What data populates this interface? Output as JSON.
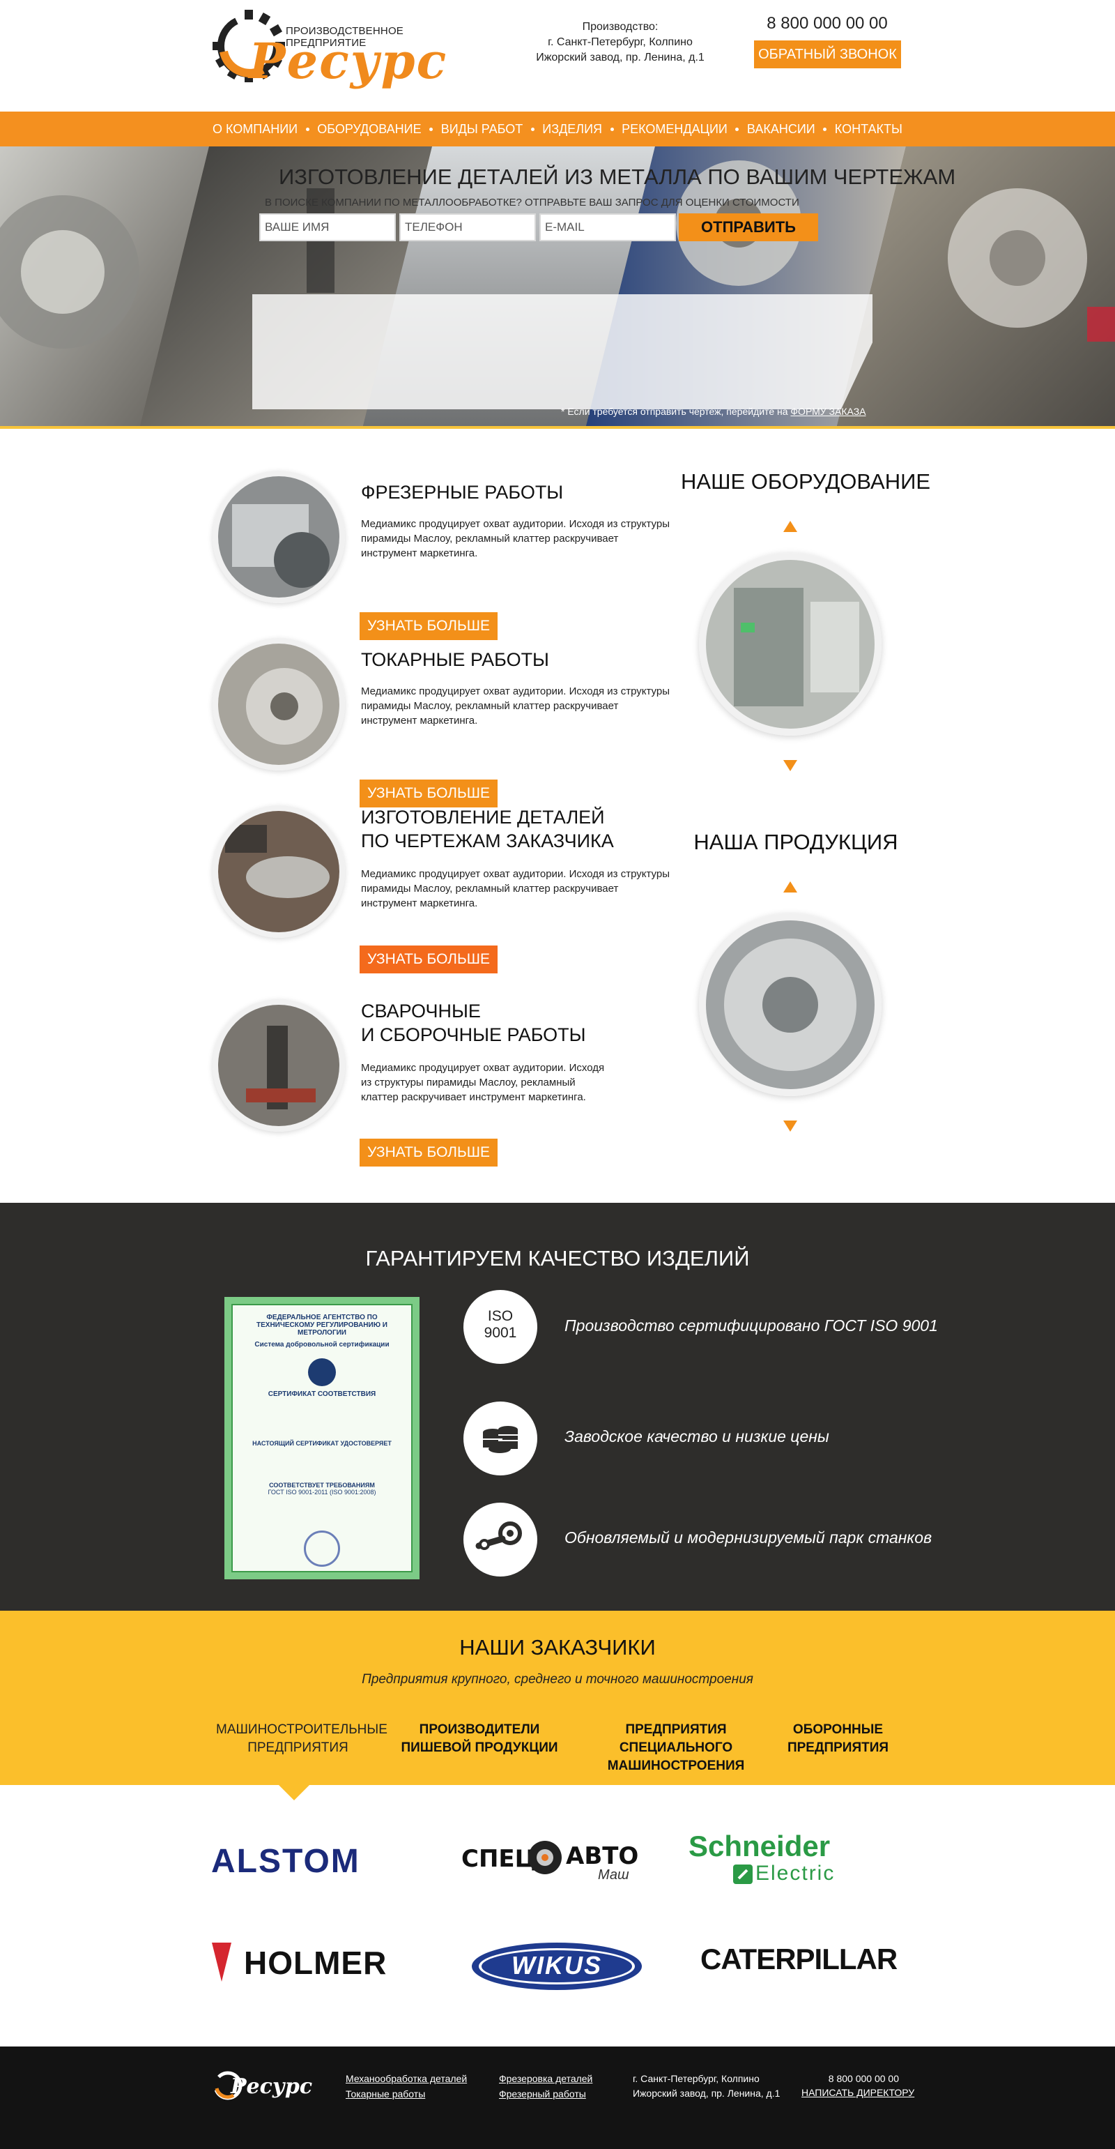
{
  "header": {
    "logo_tagline": "ПРОИЗВОДСТВЕННОЕ ПРЕДПРИЯТИЕ",
    "logo_name": "Ресурс",
    "address_lines": [
      "Производство:",
      "г. Санкт-Петербург, Колпино",
      "Ижорский завод, пр. Ленина, д.1"
    ],
    "phone": "8 800 000 00 00",
    "callback_label": "ОБРАТНЫЙ ЗВОНОК"
  },
  "nav": {
    "items": [
      "О КОМПАНИИ",
      "ОБОРУДОВАНИЕ",
      "ВИДЫ РАБОТ",
      "ИЗДЕЛИЯ",
      "РЕКОМЕНДАЦИИ",
      "ВАКАНСИИ",
      "КОНТАКТЫ"
    ]
  },
  "hero": {
    "title": "ИЗГОТОВЛЕНИЕ ДЕТАЛЕЙ ИЗ МЕТАЛЛА ПО ВАШИМ ЧЕРТЕЖАМ",
    "subtitle": "В ПОИСКЕ КОМПАНИИ ПО МЕТАЛЛООБРАБОТКЕ? ОТПРАВЬТЕ ВАШ ЗАПРОС ДЛЯ ОЦЕНКИ СТОИМОСТИ",
    "name_placeholder": "ВАШЕ ИМЯ",
    "phone_placeholder": "ТЕЛЕФОН",
    "email_placeholder": "E-MAIL",
    "submit_label": "ОТПРАВИТЬ",
    "note_prefix": "* Если требуется отправить чертеж, перейдите на ",
    "note_link": "ФОРМУ ЗАКАЗА"
  },
  "services": [
    {
      "title_lines": [
        "ФРЕЗЕРНЫЕ РАБОТЫ"
      ],
      "description": "Медиамикс продуцирует охват аудитории. Исходя из структуры пирамиды Маслоу, рекламный клаттер раскручивает инструмент маркетинга.",
      "button": "УЗНАТЬ БОЛЬШЕ"
    },
    {
      "title_lines": [
        "ТОКАРНЫЕ РАБОТЫ"
      ],
      "description": "Медиамикс продуцирует охват аудитории. Исходя из структуры пирамиды Маслоу, рекламный клаттер раскручивает инструмент маркетинга.",
      "button": "УЗНАТЬ БОЛЬШЕ"
    },
    {
      "title_lines": [
        "ИЗГОТОВЛЕНИЕ ДЕТАЛЕЙ",
        "ПО ЧЕРТЕЖАМ ЗАКАЗЧИКА"
      ],
      "description": "Медиамикс продуцирует охват аудитории. Исходя из структуры пирамиды Маслоу, рекламный клаттер раскручивает инструмент маркетинга.",
      "button": "УЗНАТЬ БОЛЬШЕ"
    },
    {
      "title_lines": [
        "СВАРОЧНЫЕ",
        "И СБОРОЧНЫЕ РАБОТЫ"
      ],
      "description": "Медиамикс продуцирует охват аудитории. Исходя из структуры пирамиды Маслоу, рекламный клаттер раскручивает инструмент маркетинга.",
      "button": "УЗНАТЬ БОЛЬШЕ"
    }
  ],
  "side": {
    "equipment_title": "НАШЕ ОБОРУДОВАНИЕ",
    "products_title": "НАША ПРОДУКЦИЯ"
  },
  "quality": {
    "title": "ГАРАНТИРУЕМ КАЧЕСТВО ИЗДЕЛИЙ",
    "iso_line1": "ISO",
    "iso_line2": "9001",
    "features": [
      "Производство  сертифицировано ГОСТ ISO 9001",
      "Заводское качество и низкие цены",
      "Обновляемый и модернизируемый парк станков"
    ],
    "certificate": {
      "agency": "ФЕДЕРАЛЬНОЕ АГЕНТСТВО ПО ТЕХНИЧЕСКОМУ РЕГУЛИРОВАНИЮ И МЕТРОЛОГИИ",
      "system": "Система добровольной сертификации",
      "heading": "СЕРТИФИКАТ СООТВЕТСТВИЯ",
      "confirms": "НАСТОЯЩИЙ СЕРТИФИКАТ УДОСТОВЕРЯЕТ",
      "complies": "СООТВЕТСТВУЕТ ТРЕБОВАНИЯМ",
      "standard": "ГОСТ ISO 9001-2011 (ISO 9001:2008)"
    }
  },
  "customers": {
    "title": "НАШИ ЗАКАЗЧИКИ",
    "subtitle": "Предприятия крупного, среднего и точного машиностроения",
    "tabs": [
      [
        "МАШИНОСТРОИТЕЛЬНЫЕ",
        "ПРЕДПРИЯТИЯ"
      ],
      [
        "ПРОИЗВОДИТЕЛИ",
        "ПИШЕВОЙ ПРОДУКЦИИ"
      ],
      [
        "ПРЕДПРИЯТИЯ СПЕЦИАЛЬНОГО",
        "МАШИНОСТРОЕНИЯ"
      ],
      [
        "ОБОРОННЫЕ",
        "ПРЕДПРИЯТИЯ"
      ]
    ]
  },
  "logos": {
    "alstom": "ALSTOM",
    "spec_a": "СПЕЦ",
    "spec_b": "АВТО",
    "spec_c": "Маш",
    "schneider_a": "Schneider",
    "schneider_b": "Electric",
    "holmer": "HOLMER",
    "wikus": "WIKUS",
    "caterpillar": "CATERPILLAR"
  },
  "footer": {
    "logo_name": "Ресурс",
    "links_col1": [
      "Механообработка деталей",
      "Токарные работы"
    ],
    "links_col2": [
      "Фрезеровка деталей",
      "Фрезерный работы"
    ],
    "address_lines": [
      "г. Санкт-Петербург, Колпино",
      "Ижорский завод, пр. Ленина, д.1"
    ],
    "phone": "8 800 000 00 00",
    "director_link": "НАПИСАТЬ ДИРЕКТОРУ"
  },
  "colors": {
    "accent": "#f39019",
    "yellow": "#fbbf2b",
    "dark": "#2e2d2b",
    "footer": "#131313"
  }
}
